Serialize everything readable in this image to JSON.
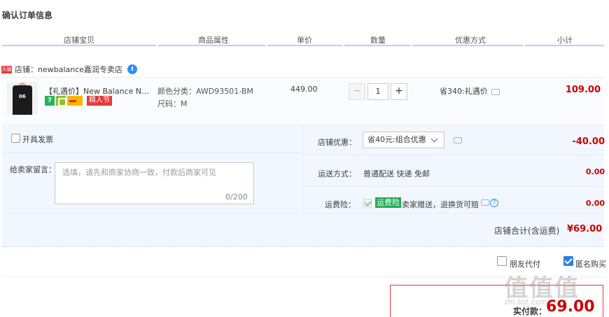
{
  "page": {
    "title": "确认订单信息"
  },
  "columns": [
    "店铺宝贝",
    "商品属性",
    "单价",
    "数量",
    "优惠方式",
    "小计"
  ],
  "shop": {
    "badge": "天猫",
    "label": "店铺：newbalance嘉润专卖店"
  },
  "item": {
    "title": "【礼遇价】New Balance NB...",
    "thumb_number": "06",
    "badge_7": "7",
    "festival_badge": "精人节",
    "attr_color": "颜色分类：AWD93501-BM",
    "attr_size": "尺码：M",
    "unit_price": "449.00",
    "quantity": "1",
    "minus": "−",
    "plus": "+",
    "promotion": "省340:礼遇价",
    "subtotal": "109.00"
  },
  "invoice": {
    "label": "开具发票"
  },
  "message": {
    "label": "给卖家留言：",
    "placeholder": "选填，请先和商家协商一致，付款后商家可见",
    "count": "0/200"
  },
  "shop_discount": {
    "label": "店铺优惠：",
    "selected": "省40元:组合优惠",
    "value": "-40.00"
  },
  "shipping": {
    "label": "运送方式：",
    "value": "普通配送 快递 免邮",
    "amount": "0.00"
  },
  "insurance": {
    "label": "运费险：",
    "badge": "运费险",
    "text": "卖家赠送，退换货可赔",
    "help": "?",
    "amount": "0.00"
  },
  "shop_total": {
    "label": "店铺合计(含运费)",
    "value": "¥69.00"
  },
  "friend_pay": {
    "label": "朋友代付"
  },
  "anonymous": {
    "label": "匿名购买"
  },
  "payment": {
    "label": "实付款：",
    "value": "69.00"
  },
  "watermark": {
    "main": "值值值",
    "sub": "zhi.biz.com"
  },
  "colors": {
    "accent_red": "#cc0000",
    "blue_line": "#b2d1ff",
    "panel_bg": "#f2f7ff",
    "checkbox_blue": "#2f7de1"
  },
  "icons": [
    "tmall-icon",
    "wangwang-icon",
    "chat-icon",
    "help-icon",
    "checkmark-icon",
    "chevron-down-icon"
  ]
}
